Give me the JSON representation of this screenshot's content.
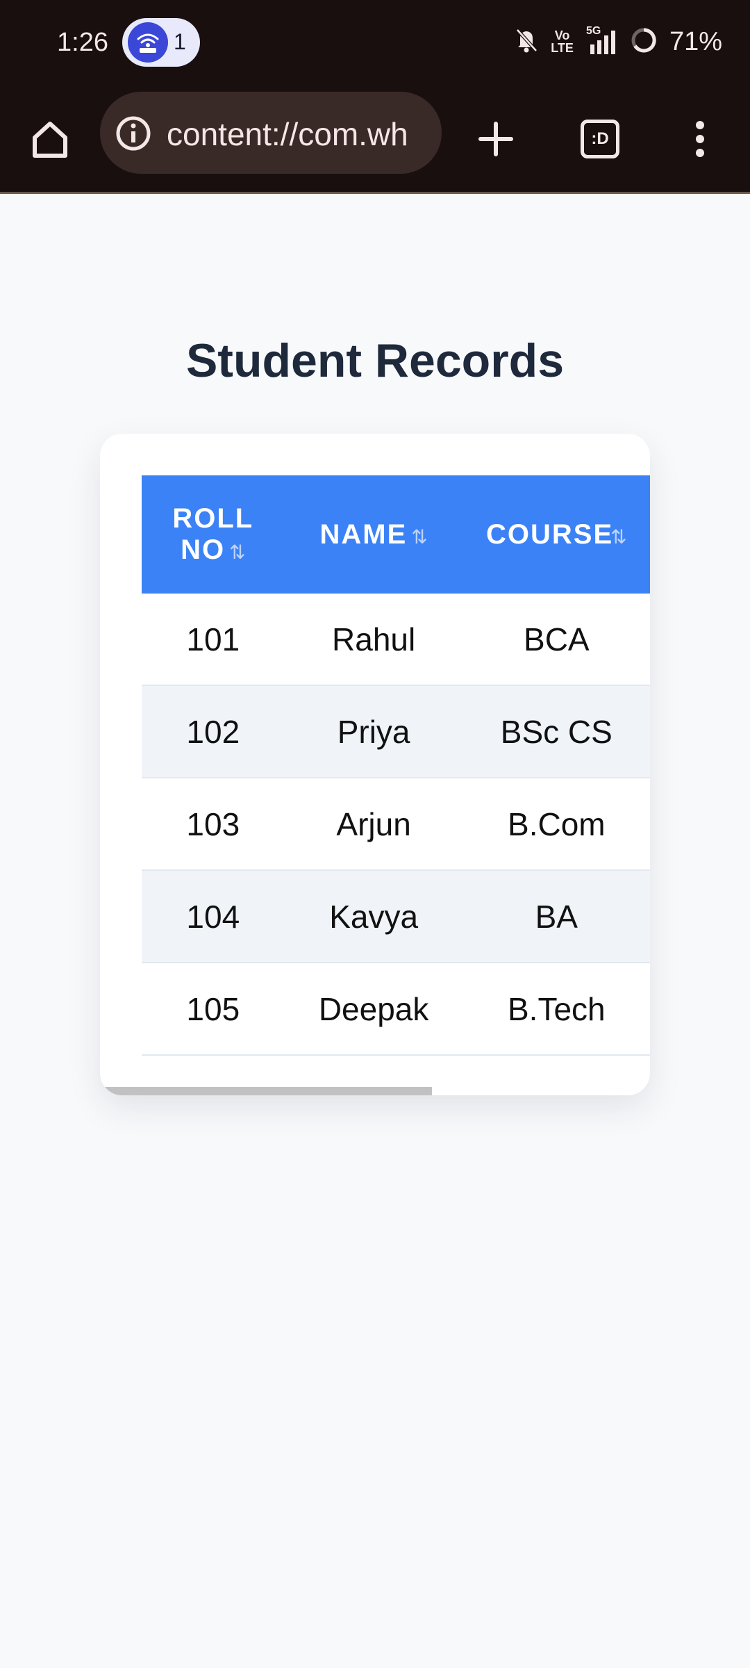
{
  "status_bar": {
    "time": "1:26",
    "hotspot_count": "1",
    "network": "5G",
    "volte_top": "Vo",
    "volte_bottom": "LTE",
    "battery": "71%"
  },
  "browser": {
    "url": "content://com.wh",
    "icons": [
      "home-icon",
      "info-icon",
      "new-tab-icon",
      "tab-switcher-icon",
      "more-menu-icon"
    ],
    "tab_switcher_label": ":D"
  },
  "page": {
    "title": "Student Records",
    "table": {
      "headers": [
        {
          "line1": "ROLL",
          "line2": "NO"
        },
        {
          "label": "NAME"
        },
        {
          "label": "COURSE"
        }
      ],
      "sort_glyph": "⇅",
      "rows": [
        [
          "101",
          "Rahul",
          "BCA"
        ],
        [
          "102",
          "Priya",
          "BSc CS"
        ],
        [
          "103",
          "Arjun",
          "B.Com"
        ],
        [
          "104",
          "Kavya",
          "BA"
        ],
        [
          "105",
          "Deepak",
          "B.Tech"
        ]
      ]
    }
  },
  "colors": {
    "header_bg": "#3b82f6",
    "title": "#1e293b",
    "browser_chrome": "#1a0f0f"
  }
}
